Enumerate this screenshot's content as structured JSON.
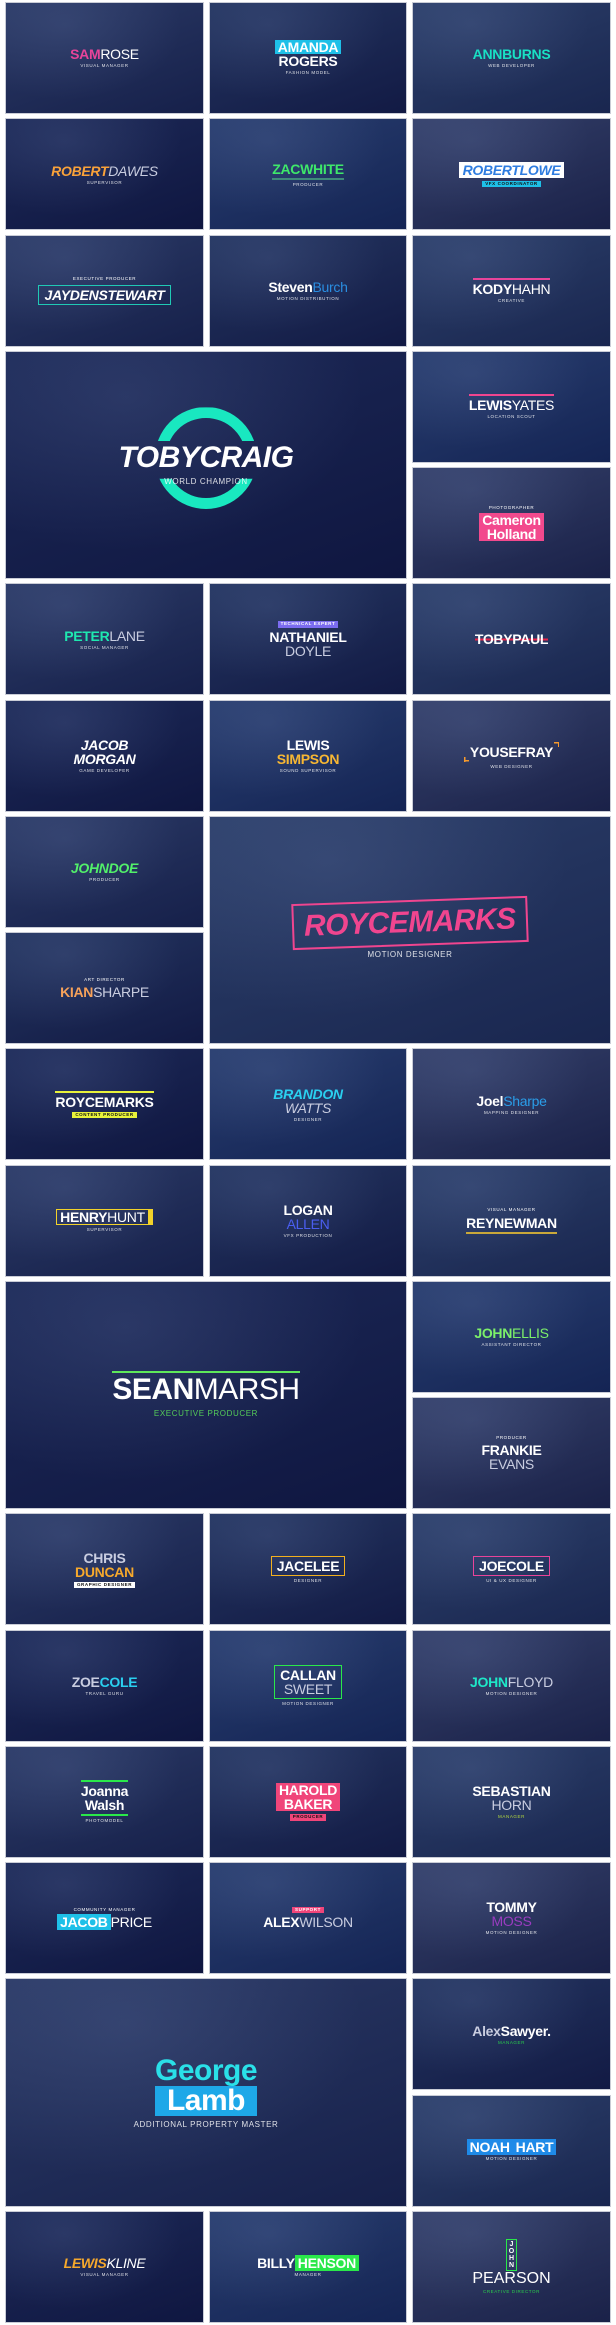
{
  "tiles": [
    {
      "first": "SAM",
      "last": "ROSE",
      "sub": "VISUAL MANAGER",
      "style": "",
      "colors": {
        "first": "#e8449a",
        "last": "#ffffff",
        "deco": "#e8449a"
      }
    },
    {
      "first": "AMANDA",
      "last": "ROGERS",
      "sub": "FASHION MODEL",
      "style": "stack bold-last badge-first",
      "colors": {
        "first": "#ffffff",
        "last": "#ffffff",
        "deco": "#1ec0e8"
      }
    },
    {
      "first": "ANN",
      "last": "BURNS",
      "sub": "WEB DEVELOPER",
      "style": "bold-last",
      "colors": {
        "first": "#19e0c4",
        "last": "#19e0c4",
        "deco": "#19e0c4"
      }
    },
    {
      "first": "ROBERT",
      "last": "DAWES",
      "sub": "SUPERVISOR",
      "style": "italic",
      "colors": {
        "first": "#f9a23a",
        "last": "#c9cde0",
        "deco": "#f9a23a"
      }
    },
    {
      "first": "ZAC",
      "last": "WHITE",
      "sub": "PRODUCER",
      "style": "bold-last line-bottom",
      "colors": {
        "first": "#3ee86a",
        "last": "#3ee86a",
        "deco": "#3e8a7a"
      }
    },
    {
      "first": "ROBERT",
      "last": "LOWE",
      "sub": "VFX COORDINATOR",
      "style": "italic bold-last badge-sub",
      "colors": {
        "first": "#2f7de0",
        "last": "#2f7de0",
        "deco": "#1ec0e8",
        "bg": "#ffffff"
      }
    },
    {
      "first": "JAYDEN",
      "last": "STEWART",
      "tag": "EXECUTIVE PRODUCER",
      "style": "italic bold-last box",
      "colors": {
        "first": "#ffffff",
        "last": "#ffffff",
        "deco": "#20c9b5"
      }
    },
    {
      "first": "Steven",
      "last": "Burch",
      "sub": "MOTION DISTRIBUTION",
      "style": "",
      "colors": {
        "first": "#ffffff",
        "last": "#2a8de0",
        "deco": "#2a8de0"
      }
    },
    {
      "first": "KODY",
      "last": "HAHN",
      "sub": "CREATIVE",
      "style": "line-top",
      "colors": {
        "first": "#ffffff",
        "last": "#ffffff",
        "deco": "#e8449a"
      }
    },
    {
      "first": "TOBY",
      "last": "CRAIG",
      "sub": "WORLD CHAMPION",
      "style": "italic bold-last ring",
      "colors": {
        "first": "#ffffff",
        "last": "#ffffff",
        "deco": "#19e8c0"
      }
    },
    {
      "first": "LEWIS",
      "last": "YATES",
      "sub": "LOCATION SCOUT",
      "style": "line-top",
      "colors": {
        "first": "#ffffff",
        "last": "#ffffff",
        "deco": "#f0458f"
      }
    },
    {
      "first": "Cameron",
      "last": "Holland",
      "tag": "PHOTOGRAPHER",
      "style": "stack bold-last badge-first badge-last",
      "colors": {
        "first": "#ffffff",
        "last": "#ffffff",
        "deco": "#f2498d"
      }
    },
    {
      "first": "PETER",
      "last": "LANE",
      "sub": "SOCIAL MANAGER",
      "style": "",
      "colors": {
        "first": "#1ee8b0",
        "last": "#c9cde0",
        "deco": "#1ee8b0"
      }
    },
    {
      "first": "NATHANIEL",
      "last": "DOYLE",
      "tag": "TECHNICAL EXPERT",
      "style": "stack badge-tag",
      "colors": {
        "first": "#ffffff",
        "last": "#c9cde0",
        "deco": "#7b6cf0"
      }
    },
    {
      "first": "TOBY",
      "last": "PAUL",
      "sub": "",
      "tag": "",
      "style": "bold-last strike",
      "colors": {
        "first": "#ffffff",
        "last": "#ffffff",
        "deco": "#e8244a"
      }
    },
    {
      "first": "JACOB",
      "last": "MORGAN",
      "sub": "GAME DEVELOPER",
      "style": "stack italic bold-last",
      "colors": {
        "first": "#ffffff",
        "last": "#ffffff",
        "deco": "#f05a9a"
      }
    },
    {
      "first": "LEWIS",
      "last": "SIMPSON",
      "sub": "SOUND SUPERVISOR",
      "style": "stack bold-last",
      "colors": {
        "first": "#ffffff",
        "last": "#f7b733",
        "deco": "#f7b733"
      }
    },
    {
      "first": "YOUSEF",
      "last": "RAY",
      "sub": "WEB DESIGNER",
      "style": "bold-last brackets",
      "colors": {
        "first": "#ffffff",
        "last": "#ffffff",
        "deco": "#f79a2c"
      }
    },
    {
      "first": "JOHN",
      "last": "DOE",
      "sub": "PRODUCER",
      "style": "italic bold-last",
      "colors": {
        "first": "#52f06a",
        "last": "#52f06a",
        "deco": "#52f06a"
      }
    },
    {
      "first": "KIAN",
      "last": "SHARPE",
      "tag": "ART DIRECTOR",
      "style": "",
      "colors": {
        "first": "#f7a25a",
        "last": "#c9cde0",
        "deco": "#ffffff"
      }
    },
    {
      "first": "ROYCE",
      "last": "MARKS",
      "sub": "MOTION DESIGNER",
      "style": "italic bold-last box",
      "colors": {
        "first": "#f0458f",
        "last": "#f0458f",
        "deco": "#f0458f"
      }
    },
    {
      "first": "ROYCE",
      "last": "MARKS",
      "sub": "CONTENT PRODUCER",
      "style": "bold-last badge-sub line-top",
      "colors": {
        "first": "#ffffff",
        "last": "#ffffff",
        "deco": "#e8f23a"
      }
    },
    {
      "first": "BRANDON",
      "last": "WATTS",
      "sub": "DESIGNER",
      "style": "stack italic",
      "colors": {
        "first": "#2ad0f0",
        "last": "#c9cde0",
        "deco": "#7b5cf0"
      }
    },
    {
      "first": "Joel",
      "last": "Sharpe",
      "sub": "MAPPING DESIGNER",
      "style": "",
      "colors": {
        "first": "#ffffff",
        "last": "#2a9de8",
        "deco": "#2a9de8"
      }
    },
    {
      "first": "HENRY",
      "last": "HUNT",
      "sub": "SUPERVISOR",
      "style": "bar-right",
      "colors": {
        "first": "#ffffff",
        "last": "#ffffff",
        "deco": "#f2d22a"
      }
    },
    {
      "first": "LOGAN",
      "last": "ALLEN",
      "sub": "VFX PRODUCTION",
      "style": "stack",
      "colors": {
        "first": "#ffffff",
        "last": "#4a5ef0",
        "deco": "#4a5ef0"
      }
    },
    {
      "first": "REY",
      "last": "NEWMAN",
      "tag": "VISUAL MANAGER",
      "style": "bold-last line-bottom",
      "colors": {
        "first": "#ffffff",
        "last": "#ffffff",
        "deco": "#c9a83a"
      }
    },
    {
      "first": "SEAN",
      "last": "MARSH",
      "sub": "EXECUTIVE PRODUCER",
      "style": "line-top",
      "colors": {
        "first": "#ffffff",
        "last": "#ffffff",
        "deco": "#5ee85a",
        "sub": "#5ee85a"
      }
    },
    {
      "first": "JOHN",
      "last": "ELLIS",
      "sub": "ASSISTANT DIRECTOR",
      "style": "",
      "colors": {
        "first": "#7cf06a",
        "last": "#7cf06a",
        "deco": "#7cf06a"
      }
    },
    {
      "first": "FRANKIE",
      "last": "EVANS",
      "tag": "PRODUCER",
      "style": "stack",
      "colors": {
        "first": "#ffffff",
        "last": "#c9cde0",
        "deco": "#f0457a"
      }
    },
    {
      "first": "CHRIS",
      "last": "DUNCAN",
      "sub": "GRAPHIC DESIGNER",
      "style": "stack bold-last badge-sub",
      "colors": {
        "first": "#c9cde0",
        "last": "#f7a92c",
        "deco": "#ffffff"
      }
    },
    {
      "first": "JACE",
      "last": "LEE",
      "sub": "DESIGNER",
      "style": "bold-last box",
      "colors": {
        "first": "#ffffff",
        "last": "#ffffff",
        "deco": "#f2b01e"
      }
    },
    {
      "first": "JOE",
      "last": "COLE",
      "sub": "UI & UX DESIGNER",
      "style": "bold-last box",
      "colors": {
        "first": "#ffffff",
        "last": "#ffffff",
        "deco": "#e8449a"
      }
    },
    {
      "first": "ZOE",
      "last": "COLE",
      "sub": "TRAVEL GURU",
      "style": "bold-last",
      "colors": {
        "first": "#c9cde0",
        "last": "#2ad0f0",
        "deco": "#2ad0f0"
      }
    },
    {
      "first": "CALLAN",
      "last": "SWEET",
      "sub": "MOTION DESIGNER",
      "style": "stack box",
      "colors": {
        "first": "#ffffff",
        "last": "#c9cde0",
        "deco": "#2ae84a"
      }
    },
    {
      "first": "JOHN",
      "last": "FLOYD",
      "sub": "MOTION DESIGNER",
      "style": "",
      "colors": {
        "first": "#1ee8c8",
        "last": "#c9cde0",
        "deco": "#1ee8c8"
      }
    },
    {
      "first": "Joanna",
      "last": "Walsh",
      "sub": "PHOTOMODEL",
      "style": "stack bold-last line-top line-bottom",
      "colors": {
        "first": "#ffffff",
        "last": "#ffffff",
        "deco": "#2ae84a"
      }
    },
    {
      "first": "HAROLD",
      "last": "BAKER",
      "sub": "PRODUCER",
      "style": "stack bold-last badge-first badge-last badge-sub",
      "colors": {
        "first": "#ffffff",
        "last": "#ffffff",
        "deco": "#f0457a"
      }
    },
    {
      "first": "SEBASTIAN",
      "last": "HORN",
      "sub": "MANAGER",
      "style": "stack",
      "colors": {
        "first": "#ffffff",
        "last": "#c9cde0",
        "deco": "#c8f03a",
        "sub": "#c8f03a"
      }
    },
    {
      "first": "JACOB",
      "last": "PRICE",
      "tag": "COMMUNITY MANAGER",
      "style": "badge-first",
      "colors": {
        "first": "#ffffff",
        "last": "#ffffff",
        "deco": "#1ec0e8"
      }
    },
    {
      "first": "ALEX",
      "last": "WILSON",
      "tag": "SUPPORT",
      "style": "badge-tag",
      "colors": {
        "first": "#ffffff",
        "last": "#c9cde0",
        "deco": "#f0457a"
      }
    },
    {
      "first": "TOMMY",
      "last": "MOSS",
      "sub": "MOTION DESIGNER",
      "style": "stack",
      "colors": {
        "first": "#ffffff",
        "last": "#9a3cc0",
        "deco": "#9a3cc0"
      }
    },
    {
      "first": "George",
      "last": "Lamb",
      "sub": "Additional Property Master",
      "style": "stack bold-last badge-last",
      "colors": {
        "first": "#2ae0e8",
        "last": "#ffffff",
        "deco": "#1ea8e8"
      }
    },
    {
      "first": "Alex",
      "last": "Sawyer.",
      "sub": "MANAGER",
      "style": "bold-last",
      "colors": {
        "first": "#c9cde0",
        "last": "#ffffff",
        "deco": "#2ae84a",
        "sub": "#2ae84a"
      }
    },
    {
      "first": "NOAH",
      "last": "HART",
      "sub": "MOTION DESIGNER",
      "style": "bold-last badge-first badge-last",
      "colors": {
        "first": "#ffffff",
        "last": "#ffffff",
        "deco": "#1e8ae8"
      }
    },
    {
      "first": "LEWIS",
      "last": "KLINE",
      "sub": "VISUAL MANAGER",
      "style": "italic",
      "colors": {
        "first": "#f7a92c",
        "last": "#ffffff",
        "deco": "#f7a92c"
      }
    },
    {
      "first": "BILLY",
      "last": "HENSON",
      "sub": "MANAGER",
      "style": "badge-last",
      "colors": {
        "first": "#ffffff",
        "last": "#ffffff",
        "deco": "#2ae84a"
      }
    },
    {
      "first": "JOHN",
      "last": "PEARSON",
      "sub": "Creative Director",
      "style": "vertical row-dir",
      "colors": {
        "first": "#ffffff",
        "last": "#ffffff",
        "deco": "#2ae84a",
        "sub": "#2ae84a"
      }
    }
  ]
}
